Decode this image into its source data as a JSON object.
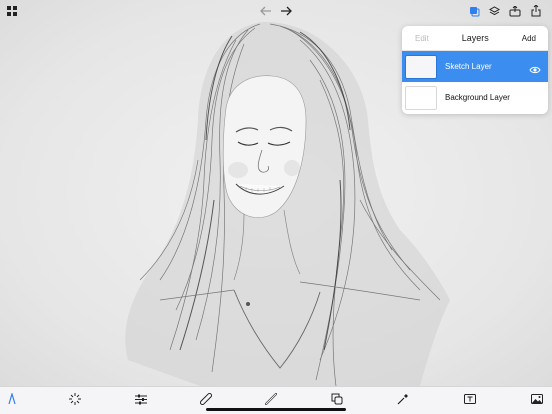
{
  "layers_panel": {
    "edit_label": "Edit",
    "title": "Layers",
    "add_label": "Add",
    "layers": [
      {
        "name": "Sketch Layer",
        "selected": true,
        "visible": true
      },
      {
        "name": "Background Layer",
        "selected": false,
        "visible": false
      }
    ]
  },
  "toolbar_top": {
    "left_icons": [
      "grid-icon"
    ],
    "center_icons": [
      "undo-arrow-icon",
      "redo-arrow-icon"
    ],
    "right_icons": [
      "layers-active-icon",
      "layers-stack-icon",
      "export-tray-icon",
      "share-icon"
    ]
  },
  "toolbar_bottom": {
    "icons": [
      "pen-tool-icon",
      "magic-selection-icon",
      "adjustments-icon",
      "bandage-icon",
      "ruler-icon",
      "shapes-icon",
      "eyedropper-icon",
      "text-tool-icon",
      "image-insert-icon"
    ]
  },
  "colors": {
    "accent": "#3b8ef0",
    "selected_layer": "#3b8ef0",
    "disabled_text": "#b9b9b9"
  }
}
